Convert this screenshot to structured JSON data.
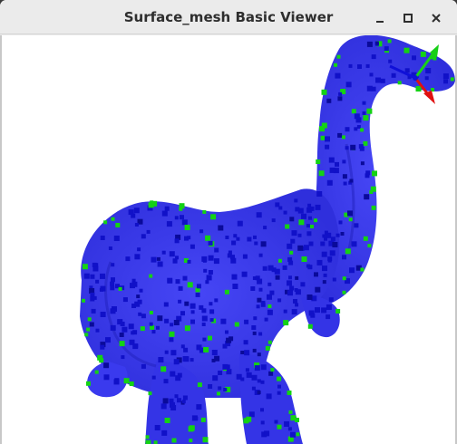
{
  "window": {
    "title": "Surface_mesh Basic Viewer",
    "controls": {
      "minimize_icon": "minimize-icon",
      "maximize_icon": "maximize-icon",
      "close_icon": "close-icon"
    }
  },
  "viewer": {
    "background_color": "#ffffff",
    "mesh_face_color": "#3b3bf0",
    "mesh_shade_color": "#2a2ad0",
    "vertex_colors": [
      "#1111c8",
      "#14d214",
      "#0a0a9a"
    ],
    "axes": {
      "x_color": "#e01010",
      "y_color": "#18d018",
      "z_color": "#1010d8"
    }
  }
}
